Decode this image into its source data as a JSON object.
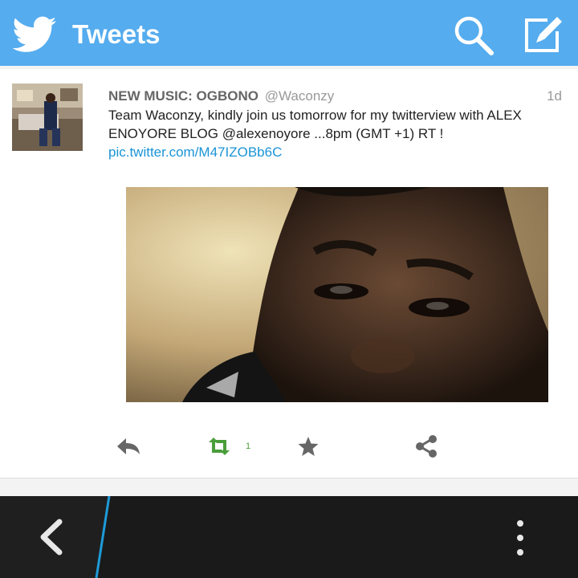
{
  "header": {
    "title": "Tweets",
    "background": "#55acee",
    "icons": {
      "logo": "twitter-bird-icon",
      "search": "search-icon",
      "compose": "compose-icon"
    }
  },
  "tweet": {
    "name": "NEW MUSIC: OGBONO",
    "handle": "@Waconzy",
    "time": "1d",
    "text": "Team Waconzy, kindly join us tomorrow for my twitterview with ALEX ENOYORE BLOG @alexenoyore ...8pm (GMT +1) RT ! ",
    "link": "pic.twitter.com/M47IZOBb6C",
    "retweet_count": "1",
    "link_color": "#1a94d6"
  },
  "actions": {
    "reply": "reply-icon",
    "retweet": "retweet-icon",
    "favorite": "star-icon",
    "share": "share-icon"
  },
  "bottom_bar": {
    "back": "back-chevron-icon",
    "menu": "overflow-menu-icon",
    "accent": "#1e9bd8"
  }
}
